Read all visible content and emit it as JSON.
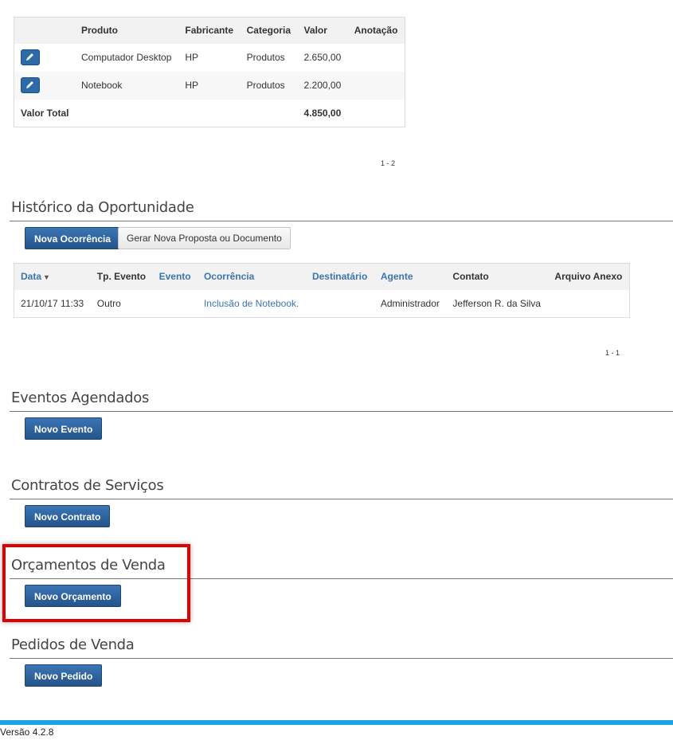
{
  "products_table": {
    "headers": [
      "",
      "Produto",
      "Fabricante",
      "Categoria",
      "Valor",
      "Anotação"
    ],
    "rows": [
      {
        "produto": "Computador Desktop",
        "fabricante": "HP",
        "categoria": "Produtos",
        "valor": "2.650,00",
        "anotacao": ""
      },
      {
        "produto": "Notebook",
        "fabricante": "HP",
        "categoria": "Produtos",
        "valor": "2.200,00",
        "anotacao": ""
      }
    ],
    "total_label": "Valor Total",
    "total_value": "4.850,00",
    "pager": "1 - 2"
  },
  "historico": {
    "title": "Histórico da Oportunidade",
    "btn_nova_ocorrencia": "Nova Ocorrência",
    "btn_gerar_proposta": "Gerar Nova Proposta ou Documento",
    "headers": {
      "data": "Data",
      "tp_evento": "Tp. Evento",
      "evento": "Evento",
      "ocorrencia": "Ocorrência",
      "destinatario": "Destinatário",
      "agente": "Agente",
      "contato": "Contato",
      "arquivo": "Arquivo Anexo"
    },
    "rows": [
      {
        "data": "21/10/17 11:33",
        "tp_evento": "Outro",
        "evento": "",
        "ocorrencia": "Inclusão de Notebook.",
        "destinatario": "",
        "agente": "Administrador",
        "contato": "Jefferson R. da Silva",
        "arquivo": ""
      }
    ],
    "pager": "1 - 1"
  },
  "eventos": {
    "title": "Eventos Agendados",
    "button": "Novo Evento"
  },
  "contratos": {
    "title": "Contratos de Serviços",
    "button": "Novo Contrato"
  },
  "orcamentos": {
    "title": "Orçamentos de Venda",
    "button": "Novo Orçamento"
  },
  "pedidos": {
    "title": "Pedidos de Venda",
    "button": "Novo Pedido"
  },
  "footer": {
    "version": "Versão 4.2.8"
  },
  "colors": {
    "primary_button": "#2a5d97",
    "link": "#3d74b0",
    "highlight": "#e10000",
    "footer_bar": "#1aa3df"
  },
  "icons": {
    "edit": "pencil-icon",
    "sort": "sort-down-icon"
  }
}
